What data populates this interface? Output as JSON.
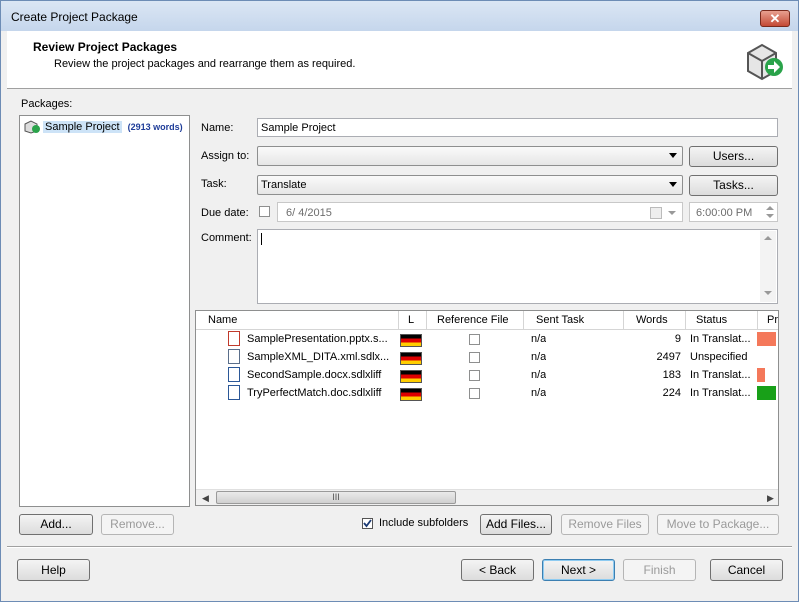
{
  "window": {
    "title": "Create Project Package",
    "close_glyph": "✕"
  },
  "header": {
    "title": "Review Project Packages",
    "subtitle": "Review the project packages and  rearrange them as required."
  },
  "packages": {
    "label": "Packages:",
    "items": [
      {
        "name": "Sample Project",
        "words": "(2913 words)"
      }
    ]
  },
  "form": {
    "name_label": "Name:",
    "name_value": "Sample Project",
    "assign_label": "Assign to:",
    "assign_value": "",
    "users_button": "Users...",
    "task_label": "Task:",
    "task_value": "Translate",
    "tasks_button": "Tasks...",
    "due_label": "Due date:",
    "due_date": "6/  4/2015",
    "due_time": "6:00:00 PM",
    "comment_label": "Comment:",
    "comment_value": ""
  },
  "grid": {
    "columns": [
      "Name",
      "L",
      "Reference File",
      "Sent Task",
      "Words",
      "Status",
      "Pr"
    ],
    "rows": [
      {
        "name": "SamplePresentation.pptx.s...",
        "sent": "n/a",
        "words": "9",
        "status": "In Translat...",
        "icon": "pptx-file-icon",
        "progress_color": "#f4785a",
        "progress": 1.0
      },
      {
        "name": "SampleXML_DITA.xml.sdlx...",
        "sent": "n/a",
        "words": "2497",
        "status": "Unspecified",
        "icon": "xml-file-icon",
        "progress_color": "#ffffff",
        "progress": 0
      },
      {
        "name": "SecondSample.docx.sdlxliff",
        "sent": "n/a",
        "words": "183",
        "status": "In Translat...",
        "icon": "docx-file-icon",
        "progress_color": "#f4785a",
        "progress": 0.4
      },
      {
        "name": "TryPerfectMatch.doc.sdlxliff",
        "sent": "n/a",
        "words": "224",
        "status": "In Translat...",
        "icon": "doc-file-icon",
        "progress_color": "#18a018",
        "progress": 1.0
      }
    ],
    "scroll_thumb": "III"
  },
  "actions": {
    "add": "Add...",
    "remove": "Remove...",
    "include_subfolders": "Include subfolders",
    "add_files": "Add Files...",
    "remove_files": "Remove Files",
    "move_to_package": "Move to Package..."
  },
  "footer": {
    "help": "Help",
    "back": "< Back",
    "next": "Next >",
    "finish": "Finish",
    "cancel": "Cancel"
  }
}
